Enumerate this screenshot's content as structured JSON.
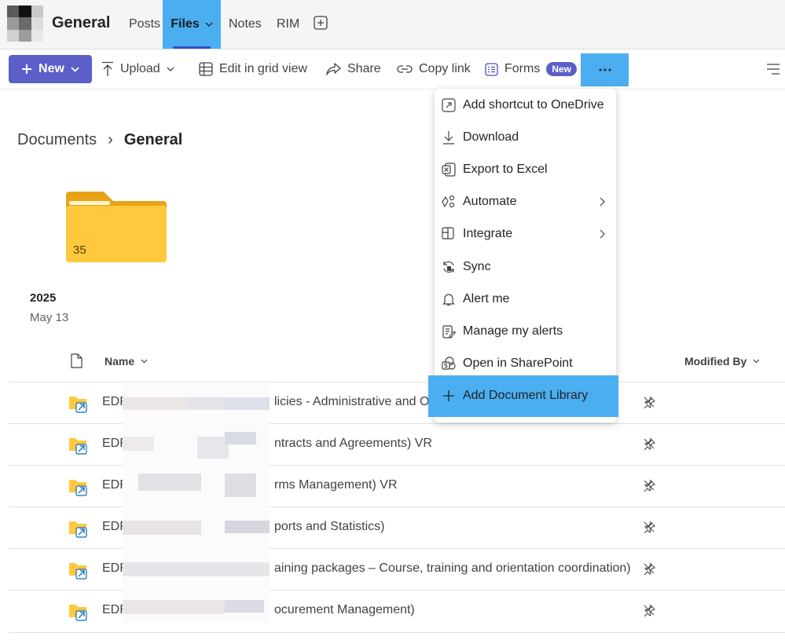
{
  "channel": {
    "name": "General"
  },
  "tabs": [
    {
      "label": "Posts"
    },
    {
      "label": "Files"
    },
    {
      "label": "Notes"
    },
    {
      "label": "RIM"
    }
  ],
  "toolbar": {
    "new_label": "New",
    "upload_label": "Upload",
    "grid_label": "Edit in grid view",
    "share_label": "Share",
    "copy_link_label": "Copy link",
    "forms_label": "Forms",
    "forms_badge": "New",
    "more_label": "···"
  },
  "breadcrumb": {
    "root": "Documents",
    "separator": "›",
    "current": "General"
  },
  "folder": {
    "count": "35",
    "year": "2025",
    "date": "May 13"
  },
  "columns": {
    "name": "Name",
    "modified_by": "Modified By"
  },
  "rows": [
    {
      "prefix": "EDF",
      "suffix": "licies - Administrative and Op"
    },
    {
      "prefix": "EDF",
      "suffix": "ntracts and Agreements) VR"
    },
    {
      "prefix": "EDF",
      "suffix": "rms Management) VR"
    },
    {
      "prefix": "EDF",
      "suffix": "ports and Statistics)"
    },
    {
      "prefix": "EDF",
      "suffix": "aining packages – Course, training and orientation coordination)"
    },
    {
      "prefix": "EDF",
      "suffix": "ocurement Management)"
    }
  ],
  "menu": {
    "items": [
      {
        "label": "Add shortcut to OneDrive",
        "icon": "shortcut-icon"
      },
      {
        "label": "Download",
        "icon": "download-icon"
      },
      {
        "label": "Export to Excel",
        "icon": "excel-icon"
      },
      {
        "label": "Automate",
        "icon": "automate-icon"
      },
      {
        "label": "Integrate",
        "icon": "integrate-icon"
      },
      {
        "label": "Sync",
        "icon": "sync-icon"
      },
      {
        "label": "Alert me",
        "icon": "bell-icon"
      },
      {
        "label": "Manage my alerts",
        "icon": "manage-alerts-icon"
      },
      {
        "label": "Open in SharePoint",
        "icon": "sharepoint-icon"
      },
      {
        "label": "Add Document Library",
        "icon": "plus-icon"
      }
    ]
  },
  "colors": {
    "accent": "#5b5fc7",
    "highlight": "#4aaef0",
    "folder": "#ffc83d"
  }
}
